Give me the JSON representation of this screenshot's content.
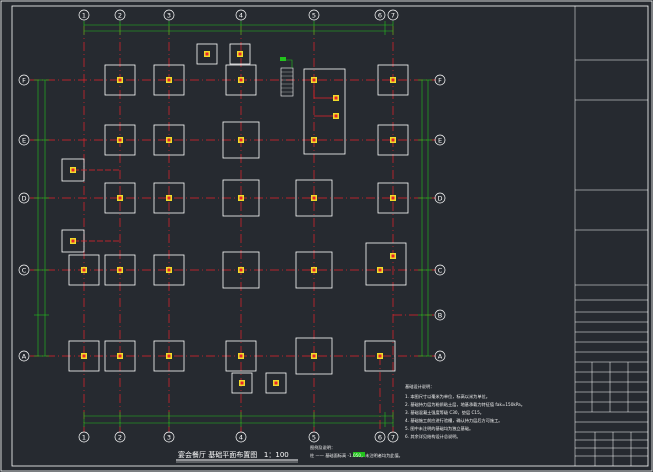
{
  "colors": {
    "background": "#262a30",
    "axis": "#e8232a",
    "dim": "#22c41c",
    "footing": "#ffffff",
    "pier": "#f0dc2a",
    "pier_core": "#e8232a",
    "frame": "#ffffff",
    "callout": "#22c41c"
  },
  "axes": {
    "cols": [
      "1",
      "2",
      "3",
      "4",
      "5",
      "6",
      "7"
    ],
    "rows": [
      "F",
      "E",
      "D",
      "C",
      "B",
      "A"
    ]
  },
  "drawing": {
    "title": "宴会餐厅 基础平面布置图",
    "scale": "1：100"
  },
  "notes": {
    "heading": "基础设计说明：",
    "lines": [
      "1. 本图尺寸以毫米为单位，标高以米为单位。",
      "2. 基础持力层为粉质粘土层，地基承载力特征值 fak=150kPa。",
      "3. 基础混凝土强度等级 C30，垫层 C15。",
      "4. 基础施工前应进行验槽，确认持力层后方可施工。",
      "5. 图中未注明的基础均为独立基础。",
      "6. 其余详见结构设计总说明。"
    ],
    "legend_heading": "图例及说明：",
    "legend_line": "柱 ——  基础面标高 -1.050，未注明者均为此值。"
  }
}
